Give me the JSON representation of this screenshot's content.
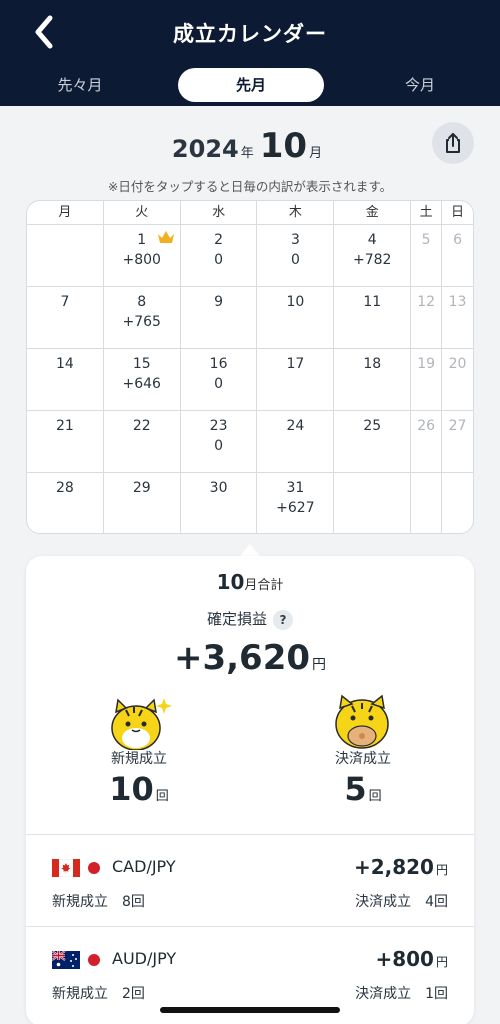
{
  "header": {
    "title": "成立カレンダー",
    "tabs": [
      "先々月",
      "先月",
      "今月"
    ],
    "active_tab": "先月",
    "background_color": "#0c1b33"
  },
  "month": {
    "year": "2024",
    "year_unit": "年",
    "month": "10",
    "month_unit": "月",
    "note": "※日付をタップすると日毎の内訳が表示されます。"
  },
  "calendar": {
    "weekdays": [
      "月",
      "火",
      "水",
      "木",
      "金",
      "土",
      "日"
    ],
    "weeks": [
      [
        {
          "d": "",
          "v": ""
        },
        {
          "d": "1",
          "v": "+800",
          "crown": true
        },
        {
          "d": "2",
          "v": "0"
        },
        {
          "d": "3",
          "v": "0"
        },
        {
          "d": "4",
          "v": "+782"
        },
        {
          "d": "5",
          "v": ""
        },
        {
          "d": "6",
          "v": ""
        }
      ],
      [
        {
          "d": "7",
          "v": ""
        },
        {
          "d": "8",
          "v": "+765"
        },
        {
          "d": "9",
          "v": ""
        },
        {
          "d": "10",
          "v": ""
        },
        {
          "d": "11",
          "v": ""
        },
        {
          "d": "12",
          "v": ""
        },
        {
          "d": "13",
          "v": ""
        }
      ],
      [
        {
          "d": "14",
          "v": ""
        },
        {
          "d": "15",
          "v": "+646"
        },
        {
          "d": "16",
          "v": "0"
        },
        {
          "d": "17",
          "v": ""
        },
        {
          "d": "18",
          "v": ""
        },
        {
          "d": "19",
          "v": ""
        },
        {
          "d": "20",
          "v": ""
        }
      ],
      [
        {
          "d": "21",
          "v": ""
        },
        {
          "d": "22",
          "v": ""
        },
        {
          "d": "23",
          "v": "0"
        },
        {
          "d": "24",
          "v": ""
        },
        {
          "d": "25",
          "v": ""
        },
        {
          "d": "26",
          "v": ""
        },
        {
          "d": "27",
          "v": ""
        }
      ],
      [
        {
          "d": "28",
          "v": ""
        },
        {
          "d": "29",
          "v": ""
        },
        {
          "d": "30",
          "v": ""
        },
        {
          "d": "31",
          "v": "+627"
        },
        {
          "d": "",
          "v": ""
        },
        {
          "d": "",
          "v": ""
        },
        {
          "d": "",
          "v": ""
        }
      ]
    ]
  },
  "summary": {
    "month": "10",
    "month_suffix": "月合計",
    "profit_label": "確定損益",
    "help_icon": "?",
    "total": "+3,620",
    "total_unit": "円",
    "new_label": "新規成立",
    "new_count": "10",
    "close_label": "決済成立",
    "close_count": "5",
    "count_unit": "回"
  },
  "pairs": [
    {
      "flag": "canada-flag-icon",
      "name": "CAD/JPY",
      "profit": "+2,820",
      "unit": "円",
      "new_label": "新規成立",
      "new_count": "8回",
      "close_label": "決済成立",
      "close_count": "4回"
    },
    {
      "flag": "australia-flag-icon",
      "name": "AUD/JPY",
      "profit": "+800",
      "unit": "円",
      "new_label": "新規成立",
      "new_count": "2回",
      "close_label": "決済成立",
      "close_count": "1回"
    }
  ]
}
